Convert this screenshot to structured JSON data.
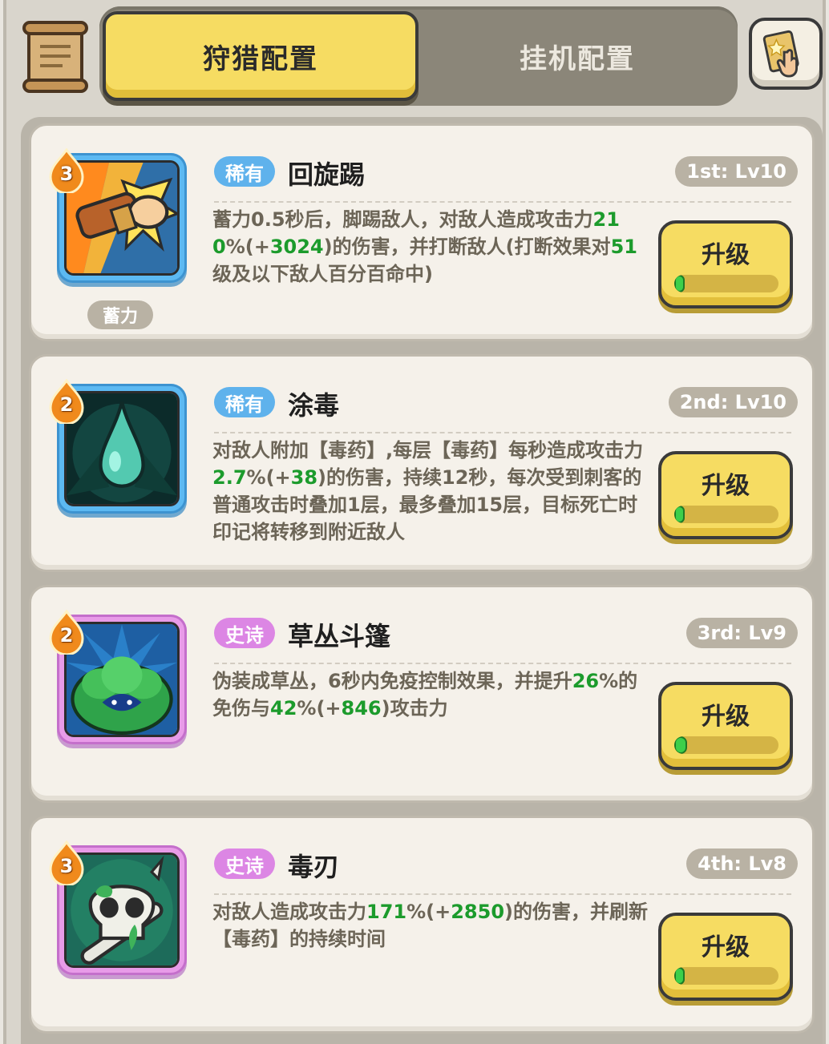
{
  "tabs": {
    "active": "狩猎配置",
    "inactive": "挂机配置"
  },
  "skills": [
    {
      "rarity": "稀有",
      "rarity_type": "rare",
      "name": "回旋踢",
      "cost": "3",
      "tag": "蓄力",
      "level": "1st: Lv10",
      "upgrade": "升级",
      "progress": 0.02,
      "desc": [
        {
          "t": "蓄力0.5秒后，脚踢敌人，对敌人造成攻击力"
        },
        {
          "t": "210",
          "g": true
        },
        {
          "t": "%(+"
        },
        {
          "t": "3024",
          "g": true
        },
        {
          "t": ")的伤害，并打断敌人(打断效果对"
        },
        {
          "t": "51",
          "g": true
        },
        {
          "t": "级及以下敌人百分百命中)"
        }
      ]
    },
    {
      "rarity": "稀有",
      "rarity_type": "rare",
      "name": "涂毒",
      "cost": "2",
      "level": "2nd: Lv10",
      "upgrade": "升级",
      "progress": 0.02,
      "desc": [
        {
          "t": "对敌人附加【毒药】,每层【毒药】每秒造成攻击力"
        },
        {
          "t": "2.7",
          "g": true
        },
        {
          "t": "%(+"
        },
        {
          "t": "38",
          "g": true
        },
        {
          "t": ")的伤害，持续12秒，每次受到刺客的普通攻击时叠加1层，最多叠加15层，目标死亡时印记将转移到附近敌人"
        }
      ]
    },
    {
      "rarity": "史诗",
      "rarity_type": "epic",
      "name": "草丛斗篷",
      "cost": "2",
      "level": "3rd: Lv9",
      "upgrade": "升级",
      "progress": 0.12,
      "desc": [
        {
          "t": "伪装成草丛，6秒内免疫控制效果，并提升"
        },
        {
          "t": "26",
          "g": true
        },
        {
          "t": "%的免伤与"
        },
        {
          "t": "42",
          "g": true
        },
        {
          "t": "%(+"
        },
        {
          "t": "846",
          "g": true
        },
        {
          "t": ")攻击力"
        }
      ]
    },
    {
      "rarity": "史诗",
      "rarity_type": "epic",
      "name": "毒刃",
      "cost": "3",
      "level": "4th: Lv8",
      "upgrade": "升级",
      "progress": 0.02,
      "desc": [
        {
          "t": "对敌人造成攻击力"
        },
        {
          "t": "171",
          "g": true
        },
        {
          "t": "%(+"
        },
        {
          "t": "2850",
          "g": true
        },
        {
          "t": ")的伤害，并刷新【毒药】的持续时间"
        }
      ]
    }
  ],
  "icons": [
    "scroll-icon",
    "tap-guide-icon",
    "kick-icon",
    "poison-drop-icon",
    "bush-cloak-icon",
    "poison-skull-icon"
  ],
  "colors": {
    "accent_yellow": "#f6dc62",
    "highlight_green": "#1c9b2c",
    "rare_blue": "#5fb2ec",
    "epic_purple": "#dc86e4"
  }
}
